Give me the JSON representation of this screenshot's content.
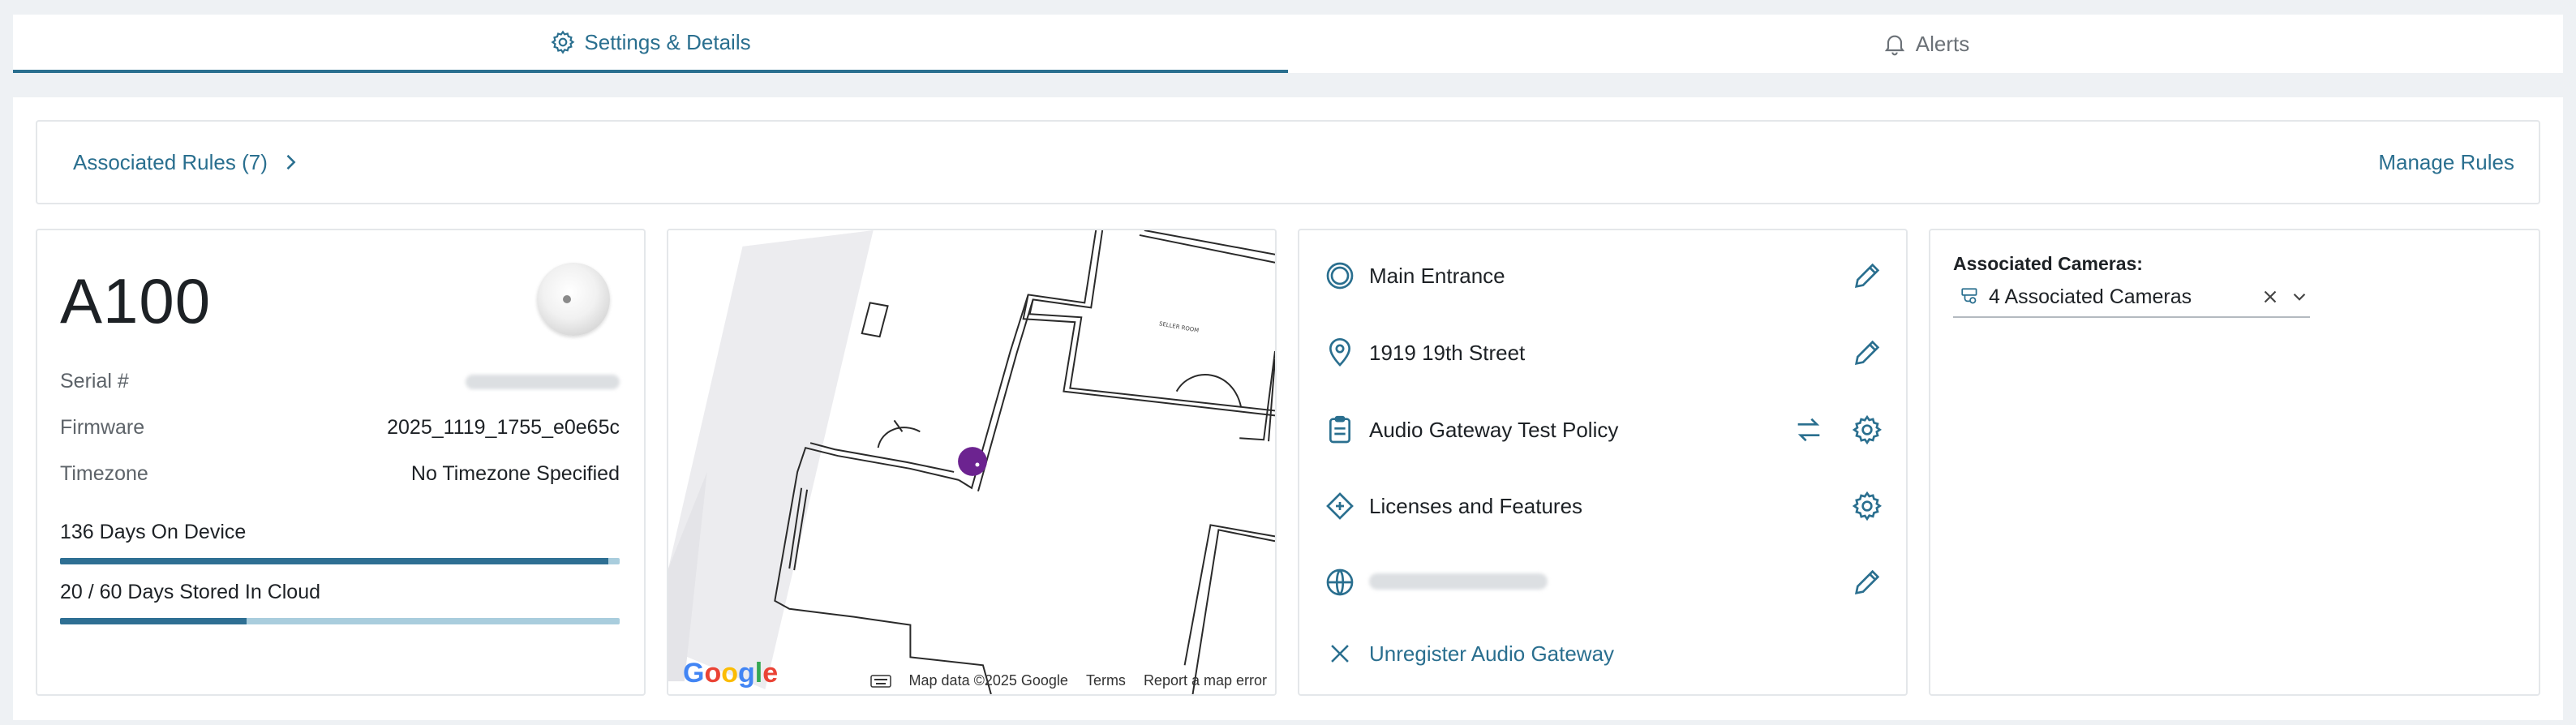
{
  "tabs": [
    {
      "label": "Settings & Details",
      "icon": "gear-icon",
      "active": true
    },
    {
      "label": "Alerts",
      "icon": "bell-icon",
      "active": false
    }
  ],
  "rules_bar": {
    "associated_rules": "Associated Rules (7)",
    "manage_rules": "Manage Rules"
  },
  "device": {
    "model": "A100",
    "serial_label": "Serial #",
    "firmware_label": "Firmware",
    "firmware_value": "2025_1119_1755_e0e65c",
    "timezone_label": "Timezone",
    "timezone_value": "No Timezone Specified",
    "days_on_device": "136 Days On Device",
    "days_on_device_fraction": 0.98,
    "days_in_cloud": "20 / 60 Days Stored In Cloud",
    "days_in_cloud_fraction": 0.333
  },
  "map": {
    "logo": "Google",
    "map_data": "Map data ©2025 Google",
    "terms": "Terms",
    "report": "Report a map error",
    "floor_label": "SELLER ROOM"
  },
  "details": {
    "location": "Main Entrance",
    "address": "1919 19th Street",
    "policy": "Audio Gateway Test Policy",
    "licenses": "Licenses and Features",
    "unregister": "Unregister Audio Gateway"
  },
  "cameras": {
    "title": "Associated Cameras:",
    "value": "4 Associated Cameras"
  },
  "colors": {
    "accent": "#2a6f8f",
    "pin": "#6c2390",
    "bar_fill": "#2e6f93",
    "bar_track": "#a9cddd"
  }
}
